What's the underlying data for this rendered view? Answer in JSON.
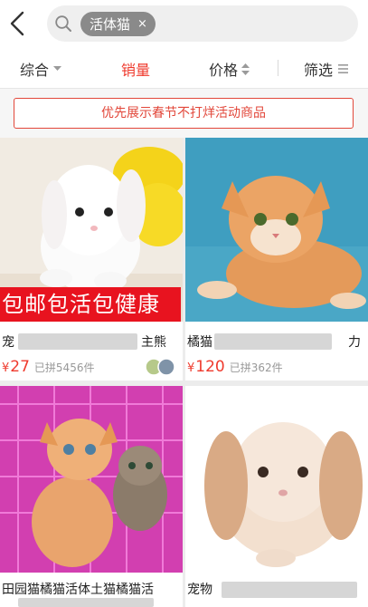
{
  "search": {
    "tag": "活体猫",
    "clear": "×"
  },
  "sort": {
    "comprehensive": "综合",
    "sales": "销量",
    "price": "价格",
    "filter": "筛选"
  },
  "promo": "优先展示春节不打烊活动商品",
  "products": [
    {
      "title_start": "宠",
      "title_end": "主熊",
      "banner": "包邮包活包健康",
      "currency": "¥",
      "price": "27",
      "sold": "已拼5456件"
    },
    {
      "title_start": "橘猫",
      "title_end": "力",
      "currency": "¥",
      "price": "120",
      "sold": "已拼362件"
    },
    {
      "title_start": "田园猫橘猫活体土猫橘猫活"
    },
    {
      "title_start": "宠物"
    }
  ],
  "colors": {
    "accent": "#ef3a2d"
  }
}
